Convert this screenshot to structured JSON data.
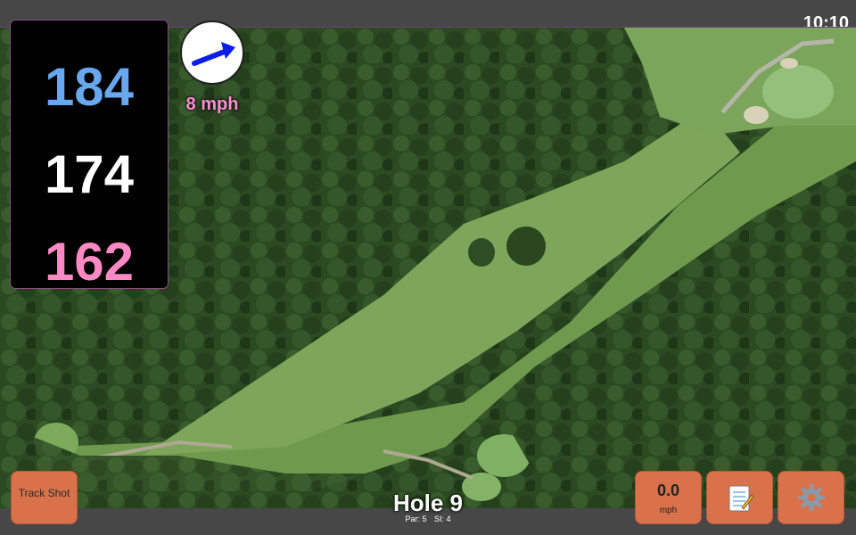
{
  "status": {
    "time": "10:10"
  },
  "distances": {
    "back": "184",
    "middle": "174",
    "front": "162"
  },
  "wind": {
    "speed_label": "8 mph",
    "icon": "arrow-icon"
  },
  "buttons": {
    "track_shot": "Track Shot",
    "wind_value": "0.0",
    "wind_unit": "mph",
    "notes_icon": "notepad-icon",
    "settings_icon": "gear-icon"
  },
  "hole": {
    "title": "Hole 9",
    "par": "Par: 5",
    "si": "SI: 4"
  },
  "colors": {
    "back": "#67a8ee",
    "middle": "#ffffff",
    "front": "#ff89c4",
    "button": "#d9714a",
    "wind_arrow": "#0a1ee8"
  }
}
